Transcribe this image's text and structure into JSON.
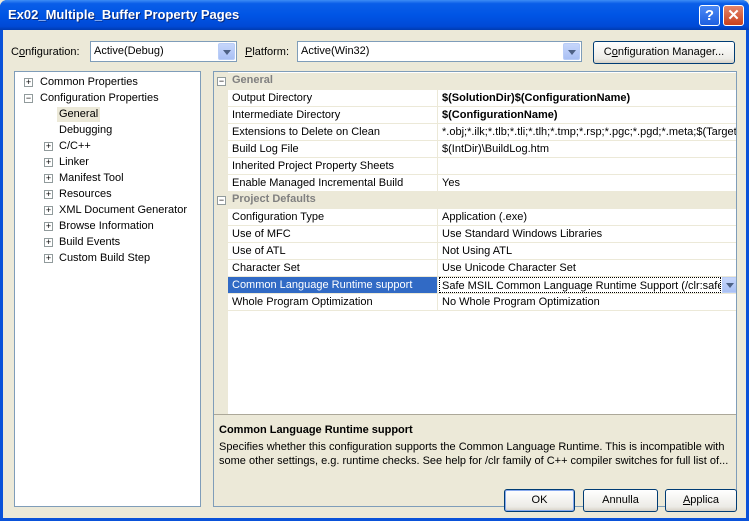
{
  "window": {
    "title": "Ex02_Multiple_Buffer Property Pages",
    "help_glyph": "?",
    "close_glyph": "✕"
  },
  "toolbar": {
    "configuration_label_pre": "C",
    "configuration_label_acc": "o",
    "configuration_label_post": "nfiguration:",
    "configuration_value": "Active(Debug)",
    "platform_label_acc": "P",
    "platform_label_post": "latform:",
    "platform_value": "Active(Win32)",
    "config_manager_pre": "C",
    "config_manager_acc": "o",
    "config_manager_post": "nfiguration Manager..."
  },
  "tree": {
    "items": [
      {
        "label": "Common Properties",
        "expander": "+"
      },
      {
        "label": "Configuration Properties",
        "expander": "−"
      },
      {
        "label": "General"
      },
      {
        "label": "Debugging"
      },
      {
        "label": "C/C++",
        "expander": "+"
      },
      {
        "label": "Linker",
        "expander": "+"
      },
      {
        "label": "Manifest Tool",
        "expander": "+"
      },
      {
        "label": "Resources",
        "expander": "+"
      },
      {
        "label": "XML Document Generator",
        "expander": "+"
      },
      {
        "label": "Browse Information",
        "expander": "+"
      },
      {
        "label": "Build Events",
        "expander": "+"
      },
      {
        "label": "Custom Build Step",
        "expander": "+"
      }
    ]
  },
  "grid": {
    "cat_general": {
      "label": "General",
      "expander": "−"
    },
    "general": [
      {
        "name": "Output Directory",
        "value": "$(SolutionDir)$(ConfigurationName)"
      },
      {
        "name": "Intermediate Directory",
        "value": "$(ConfigurationName)"
      },
      {
        "name": "Extensions to Delete on Clean",
        "value": "*.obj;*.ilk;*.tlb;*.tli;*.tlh;*.tmp;*.rsp;*.pgc;*.pgd;*.meta;$(TargetPath)"
      },
      {
        "name": "Build Log File",
        "value": "$(IntDir)\\BuildLog.htm"
      },
      {
        "name": "Inherited Project Property Sheets",
        "value": ""
      },
      {
        "name": "Enable Managed Incremental Build",
        "value": "Yes"
      }
    ],
    "cat_defaults": {
      "label": "Project Defaults",
      "expander": "−"
    },
    "defaults": [
      {
        "name": "Configuration Type",
        "value": "Application (.exe)"
      },
      {
        "name": "Use of MFC",
        "value": "Use Standard Windows Libraries"
      },
      {
        "name": "Use of ATL",
        "value": "Not Using ATL"
      },
      {
        "name": "Character Set",
        "value": "Use Unicode Character Set"
      },
      {
        "name": "Common Language Runtime support",
        "value": "Safe MSIL Common Language Runtime Support (/clr:safe)"
      },
      {
        "name": "Whole Program Optimization",
        "value": "No Whole Program Optimization"
      }
    ]
  },
  "description": {
    "title": "Common Language Runtime support",
    "text": "Specifies whether this configuration supports the Common Language Runtime.  This is incompatible with some other settings, e.g. runtime checks. See help for /clr family of C++ compiler switches for full list of..."
  },
  "buttons": {
    "ok": "OK",
    "cancel": "Annulla",
    "apply_acc": "A",
    "apply_post": "pplica"
  },
  "colors": {
    "title_bar": "#0055e5",
    "selection": "#316ac5",
    "face": "#ece9d8"
  }
}
